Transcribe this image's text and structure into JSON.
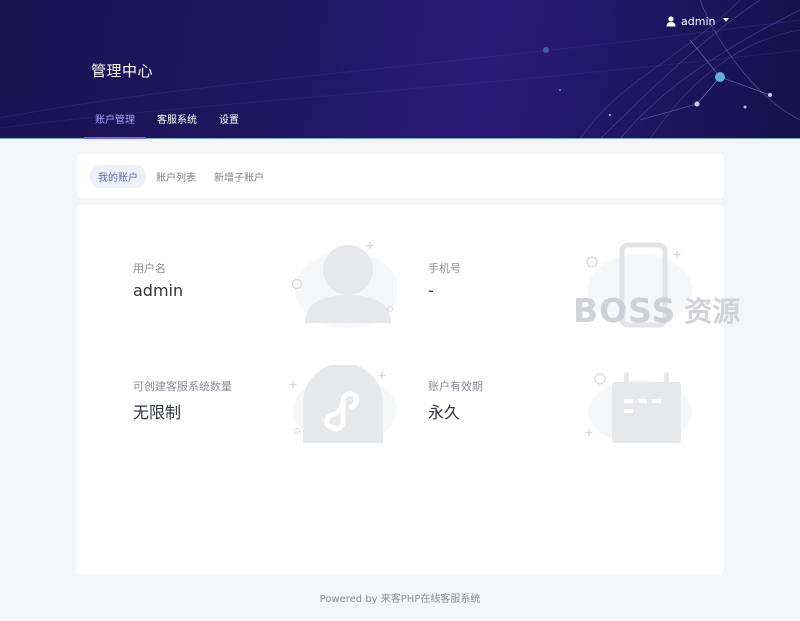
{
  "header": {
    "title": "管理中心",
    "user": {
      "name": "admin",
      "icon": "user-icon",
      "caret_icon": "caret-down-icon"
    },
    "tabs": [
      {
        "label": "账户管理",
        "active": true
      },
      {
        "label": "客服系统",
        "active": false
      },
      {
        "label": "设置",
        "active": false
      }
    ]
  },
  "subnav": {
    "items": [
      {
        "label": "我的账户",
        "active": true
      },
      {
        "label": "账户列表",
        "active": false
      },
      {
        "label": "新增子账户",
        "active": false
      }
    ]
  },
  "account": {
    "username": {
      "label": "用户名",
      "value": "admin",
      "icon": "user-illustration-icon"
    },
    "phone": {
      "label": "手机号",
      "value": "-",
      "icon": "phone-illustration-icon"
    },
    "quota": {
      "label": "可创建客服系统数量",
      "value": "无限制",
      "icon": "mini-program-illustration-icon"
    },
    "expiry": {
      "label": "账户有效期",
      "value": "永久",
      "icon": "calendar-illustration-icon"
    }
  },
  "watermark": {
    "en": "BOSS",
    "cn": "资源"
  },
  "footer": {
    "text": "Powered by 来客PHP在线客服系统"
  },
  "colors": {
    "header_bg": "#1f1660",
    "accent": "#6c63ff",
    "active_tab_text": "#a9a3f7",
    "page_bg": "#f4f5f7"
  }
}
